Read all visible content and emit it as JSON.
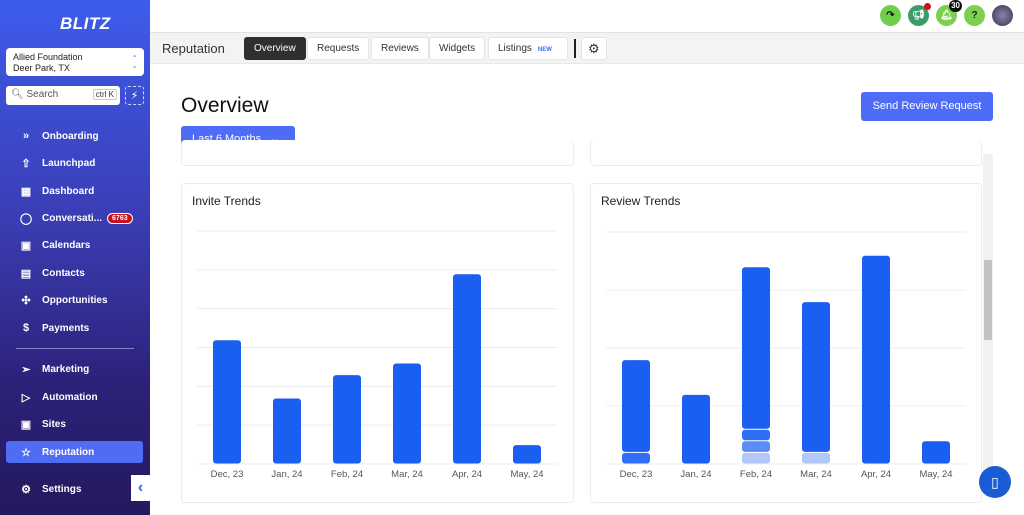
{
  "sidebar": {
    "logo": "BLITZ",
    "location": {
      "name": "Allied Foundation",
      "city": "Deer Park, TX"
    },
    "search": {
      "placeholder": "Search",
      "shortcut": "ctrl K"
    },
    "items": [
      {
        "label": "Onboarding",
        "icon": "chevrons-right"
      },
      {
        "label": "Launchpad",
        "icon": "rocket"
      },
      {
        "label": "Dashboard",
        "icon": "grid"
      },
      {
        "label": "Conversati...",
        "icon": "chat",
        "badge": "6763"
      },
      {
        "label": "Calendars",
        "icon": "calendar"
      },
      {
        "label": "Contacts",
        "icon": "contacts"
      },
      {
        "label": "Opportunities",
        "icon": "opportunities"
      },
      {
        "label": "Payments",
        "icon": "payments"
      },
      {
        "label": "Marketing",
        "icon": "send"
      },
      {
        "label": "Automation",
        "icon": "automation"
      },
      {
        "label": "Sites",
        "icon": "sites"
      },
      {
        "label": "Reputation",
        "icon": "star",
        "active": true
      },
      {
        "label": "Settings",
        "icon": "gear"
      }
    ]
  },
  "topbar": {
    "notifications_count": "30",
    "help": "?"
  },
  "subnav": {
    "title": "Reputation",
    "tabs": [
      "Overview",
      "Requests",
      "Reviews",
      "Widgets",
      "Listings"
    ],
    "new_badge": "NEW",
    "active": "Overview"
  },
  "main": {
    "title": "Overview",
    "range": "Last 6 Months",
    "send_button": "Send Review Request"
  },
  "colors": {
    "accent": "#4f6cf6",
    "bar": "#1a5ff0",
    "bar2": "#2f6ef7",
    "bar3": "#5b8cf5",
    "bar4": "#b2c8fb"
  },
  "chart_data": [
    {
      "type": "bar",
      "title": "Invite Trends",
      "categories": [
        "Dec, 23",
        "Jan, 24",
        "Feb, 24",
        "Mar, 24",
        "Apr, 24",
        "May, 24"
      ],
      "values": [
        32,
        17,
        23,
        26,
        49,
        5
      ],
      "ylim": [
        0,
        60
      ],
      "grid": true
    },
    {
      "type": "bar",
      "stacked": true,
      "title": "Review Trends",
      "categories": [
        "Dec, 23",
        "Jan, 24",
        "Feb, 24",
        "Mar, 24",
        "Apr, 24",
        "May, 24"
      ],
      "ylim": [
        0,
        40
      ],
      "grid": true,
      "series": [
        {
          "values": [
            0,
            0,
            2,
            2,
            0,
            0
          ],
          "color": "#b2c8fb"
        },
        {
          "values": [
            0,
            0,
            2,
            0,
            0,
            0
          ],
          "color": "#5b8cf5"
        },
        {
          "values": [
            2,
            0,
            2,
            0,
            0,
            0
          ],
          "color": "#2f6ef7"
        },
        {
          "values": [
            16,
            12,
            28,
            26,
            36,
            4
          ],
          "color": "#1a5ff0"
        }
      ]
    }
  ]
}
